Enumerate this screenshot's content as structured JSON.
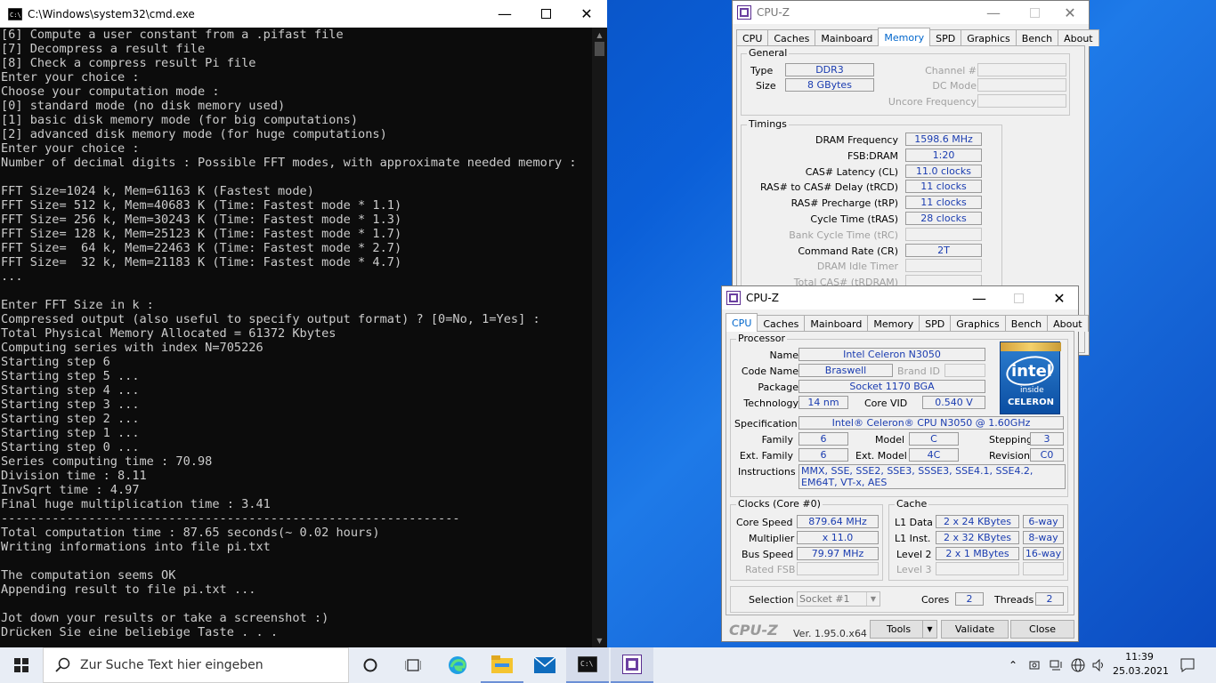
{
  "cmd": {
    "title": "C:\\Windows\\system32\\cmd.exe",
    "lines": [
      "[6] Compute a user constant from a .pifast file",
      "[7] Decompress a result file",
      "[8] Check a compress result Pi file",
      "Enter your choice :",
      "Choose your computation mode :",
      "[0] standard mode (no disk memory used)",
      "[1] basic disk memory mode (for big computations)",
      "[2] advanced disk memory mode (for huge computations)",
      "Enter your choice :",
      "Number of decimal digits : Possible FFT modes, with approximate needed memory :",
      "",
      "FFT Size=1024 k, Mem=61163 K (Fastest mode)",
      "FFT Size= 512 k, Mem=40683 K (Time: Fastest mode * 1.1)",
      "FFT Size= 256 k, Mem=30243 K (Time: Fastest mode * 1.3)",
      "FFT Size= 128 k, Mem=25123 K (Time: Fastest mode * 1.7)",
      "FFT Size=  64 k, Mem=22463 K (Time: Fastest mode * 2.7)",
      "FFT Size=  32 k, Mem=21183 K (Time: Fastest mode * 4.7)",
      "...",
      "",
      "Enter FFT Size in k :",
      "Compressed output (also useful to specify output format) ? [0=No, 1=Yes] :",
      "Total Physical Memory Allocated = 61372 Kbytes",
      "Computing series with index N=705226",
      "Starting step 6",
      "Starting step 5 ...",
      "Starting step 4 ...",
      "Starting step 3 ...",
      "Starting step 2 ...",
      "Starting step 1 ...",
      "Starting step 0 ...",
      "Series computing time : 70.98",
      "Division time : 8.11",
      "InvSqrt time : 4.97",
      "Final huge multiplication time : 3.41",
      "---------------------------------------------------------------",
      "Total computation time : 87.65 seconds(~ 0.02 hours)",
      "Writing informations into file pi.txt",
      "",
      "The computation seems OK",
      "Appending result to file pi.txt ...",
      "",
      "Jot down your results or take a screenshot :)",
      "Drücken Sie eine beliebige Taste . . ."
    ]
  },
  "cpuz_mem": {
    "title": "CPU-Z",
    "tabs": [
      "CPU",
      "Caches",
      "Mainboard",
      "Memory",
      "SPD",
      "Graphics",
      "Bench",
      "About"
    ],
    "general": {
      "label": "General",
      "type_label": "Type",
      "type": "DDR3",
      "size_label": "Size",
      "size": "8 GBytes",
      "channel_label": "Channel #",
      "dc_label": "DC Mode",
      "uncore_label": "Uncore Frequency"
    },
    "timings": {
      "label": "Timings",
      "rows": [
        {
          "l": "DRAM Frequency",
          "v": "1598.6 MHz",
          "d": false
        },
        {
          "l": "FSB:DRAM",
          "v": "1:20",
          "d": false
        },
        {
          "l": "CAS# Latency (CL)",
          "v": "11.0 clocks",
          "d": false
        },
        {
          "l": "RAS# to CAS# Delay (tRCD)",
          "v": "11 clocks",
          "d": false
        },
        {
          "l": "RAS# Precharge (tRP)",
          "v": "11 clocks",
          "d": false
        },
        {
          "l": "Cycle Time (tRAS)",
          "v": "28 clocks",
          "d": false
        },
        {
          "l": "Bank Cycle Time (tRC)",
          "v": "",
          "d": true
        },
        {
          "l": "Command Rate (CR)",
          "v": "2T",
          "d": false
        },
        {
          "l": "DRAM Idle Timer",
          "v": "",
          "d": true
        },
        {
          "l": "Total CAS# (tRDRAM)",
          "v": "",
          "d": true
        }
      ]
    }
  },
  "cpuz": {
    "title": "CPU-Z",
    "tabs": [
      "CPU",
      "Caches",
      "Mainboard",
      "Memory",
      "SPD",
      "Graphics",
      "Bench",
      "About"
    ],
    "processor": {
      "label": "Processor",
      "name_label": "Name",
      "name": "Intel Celeron N3050",
      "code_label": "Code Name",
      "code": "Braswell",
      "brand_label": "Brand ID",
      "package_label": "Package",
      "package": "Socket 1170 BGA",
      "tech_label": "Technology",
      "tech": "14 nm",
      "vid_label": "Core VID",
      "vid": "0.540 V",
      "spec_label": "Specification",
      "spec": "Intel® Celeron® CPU  N3050  @ 1.60GHz",
      "family_label": "Family",
      "family": "6",
      "model_label": "Model",
      "model": "C",
      "stepping_label": "Stepping",
      "stepping": "3",
      "extfam_label": "Ext. Family",
      "extfam": "6",
      "extmodel_label": "Ext. Model",
      "extmodel": "4C",
      "rev_label": "Revision",
      "rev": "C0",
      "instr_label": "Instructions",
      "instr": "MMX, SSE, SSE2, SSE3, SSSE3, SSE4.1, SSE4.2, EM64T, VT-x, AES",
      "logo_brand": "intel",
      "logo_inside": "inside",
      "logo_product": "CELERON"
    },
    "clocks": {
      "label": "Clocks (Core #0)",
      "core_label": "Core Speed",
      "core": "879.64 MHz",
      "mult_label": "Multiplier",
      "mult": "x 11.0",
      "bus_label": "Bus Speed",
      "bus": "79.97 MHz",
      "fsb_label": "Rated FSB"
    },
    "cache": {
      "label": "Cache",
      "l1d_label": "L1 Data",
      "l1d": "2 x 24 KBytes",
      "l1d_w": "6-way",
      "l1i_label": "L1 Inst.",
      "l1i": "2 x 32 KBytes",
      "l1i_w": "8-way",
      "l2_label": "Level 2",
      "l2": "2 x 1 MBytes",
      "l2_w": "16-way",
      "l3_label": "Level 3"
    },
    "sel_label": "Selection",
    "sel": "Socket #1",
    "cores_label": "Cores",
    "cores": "2",
    "threads_label": "Threads",
    "threads": "2",
    "brand": "CPU-Z",
    "version": "Ver. 1.95.0.x64",
    "tools": "Tools",
    "validate": "Validate",
    "close": "Close"
  },
  "taskbar": {
    "search_placeholder": "Zur Suche Text hier eingeben",
    "time": "11:39",
    "date": "25.03.2021"
  }
}
